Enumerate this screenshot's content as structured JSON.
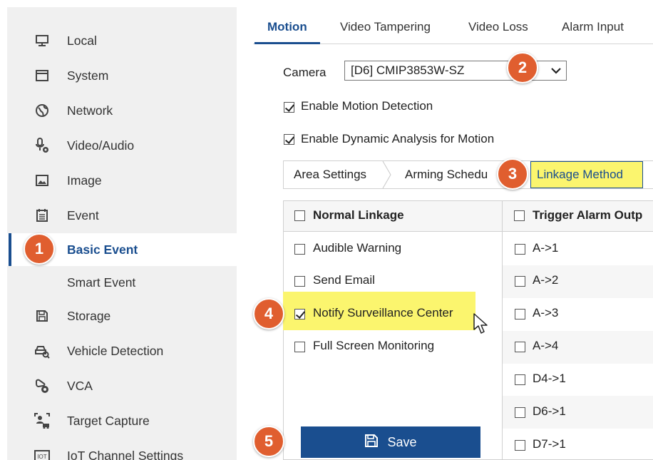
{
  "sidebar": {
    "items": [
      {
        "label": "Local",
        "icon": "monitor-icon"
      },
      {
        "label": "System",
        "icon": "window-icon"
      },
      {
        "label": "Network",
        "icon": "globe-icon"
      },
      {
        "label": "Video/Audio",
        "icon": "microphone-settings-icon"
      },
      {
        "label": "Image",
        "icon": "image-icon"
      },
      {
        "label": "Event",
        "icon": "calendar-list-icon"
      },
      {
        "label": "Basic Event",
        "icon": "",
        "active": true
      },
      {
        "label": "Smart Event",
        "icon": ""
      },
      {
        "label": "Storage",
        "icon": "floppy-disk-icon"
      },
      {
        "label": "Vehicle Detection",
        "icon": "vehicle-search-icon"
      },
      {
        "label": "VCA",
        "icon": "vca-settings-icon"
      },
      {
        "label": "Target Capture",
        "icon": "target-capture-icon"
      },
      {
        "label": "IoT Channel Settings",
        "icon": "iot-icon"
      }
    ]
  },
  "tabs": [
    {
      "label": "Motion",
      "active": true
    },
    {
      "label": "Video Tampering"
    },
    {
      "label": "Video Loss"
    },
    {
      "label": "Alarm Input"
    }
  ],
  "camera": {
    "label": "Camera",
    "value": "[D6] CMIP3853W-SZ"
  },
  "options": {
    "enable_motion": "Enable Motion Detection",
    "enable_dynamic": "Enable Dynamic Analysis for Motion"
  },
  "subtabs": {
    "area": "Area Settings",
    "arming": "Arming Schedu",
    "linkage": "Linkage Method"
  },
  "table": {
    "normal_header": "Normal Linkage",
    "trigger_header": "Trigger Alarm Outp",
    "normal_items": [
      {
        "label": "Audible Warning",
        "checked": false
      },
      {
        "label": "Send Email",
        "checked": false
      },
      {
        "label": "Notify Surveillance Center",
        "checked": true
      },
      {
        "label": "Full Screen Monitoring",
        "checked": false
      }
    ],
    "trigger_items": [
      "A->1",
      "A->2",
      "A->3",
      "A->4",
      "D4->1",
      "D6->1",
      "D7->1"
    ]
  },
  "save_label": "Save",
  "steps": [
    "1",
    "2",
    "3",
    "4",
    "5"
  ],
  "colors": {
    "accent": "#1a4e8f",
    "highlight": "#fbf56e",
    "badge": "#e05e2f"
  }
}
